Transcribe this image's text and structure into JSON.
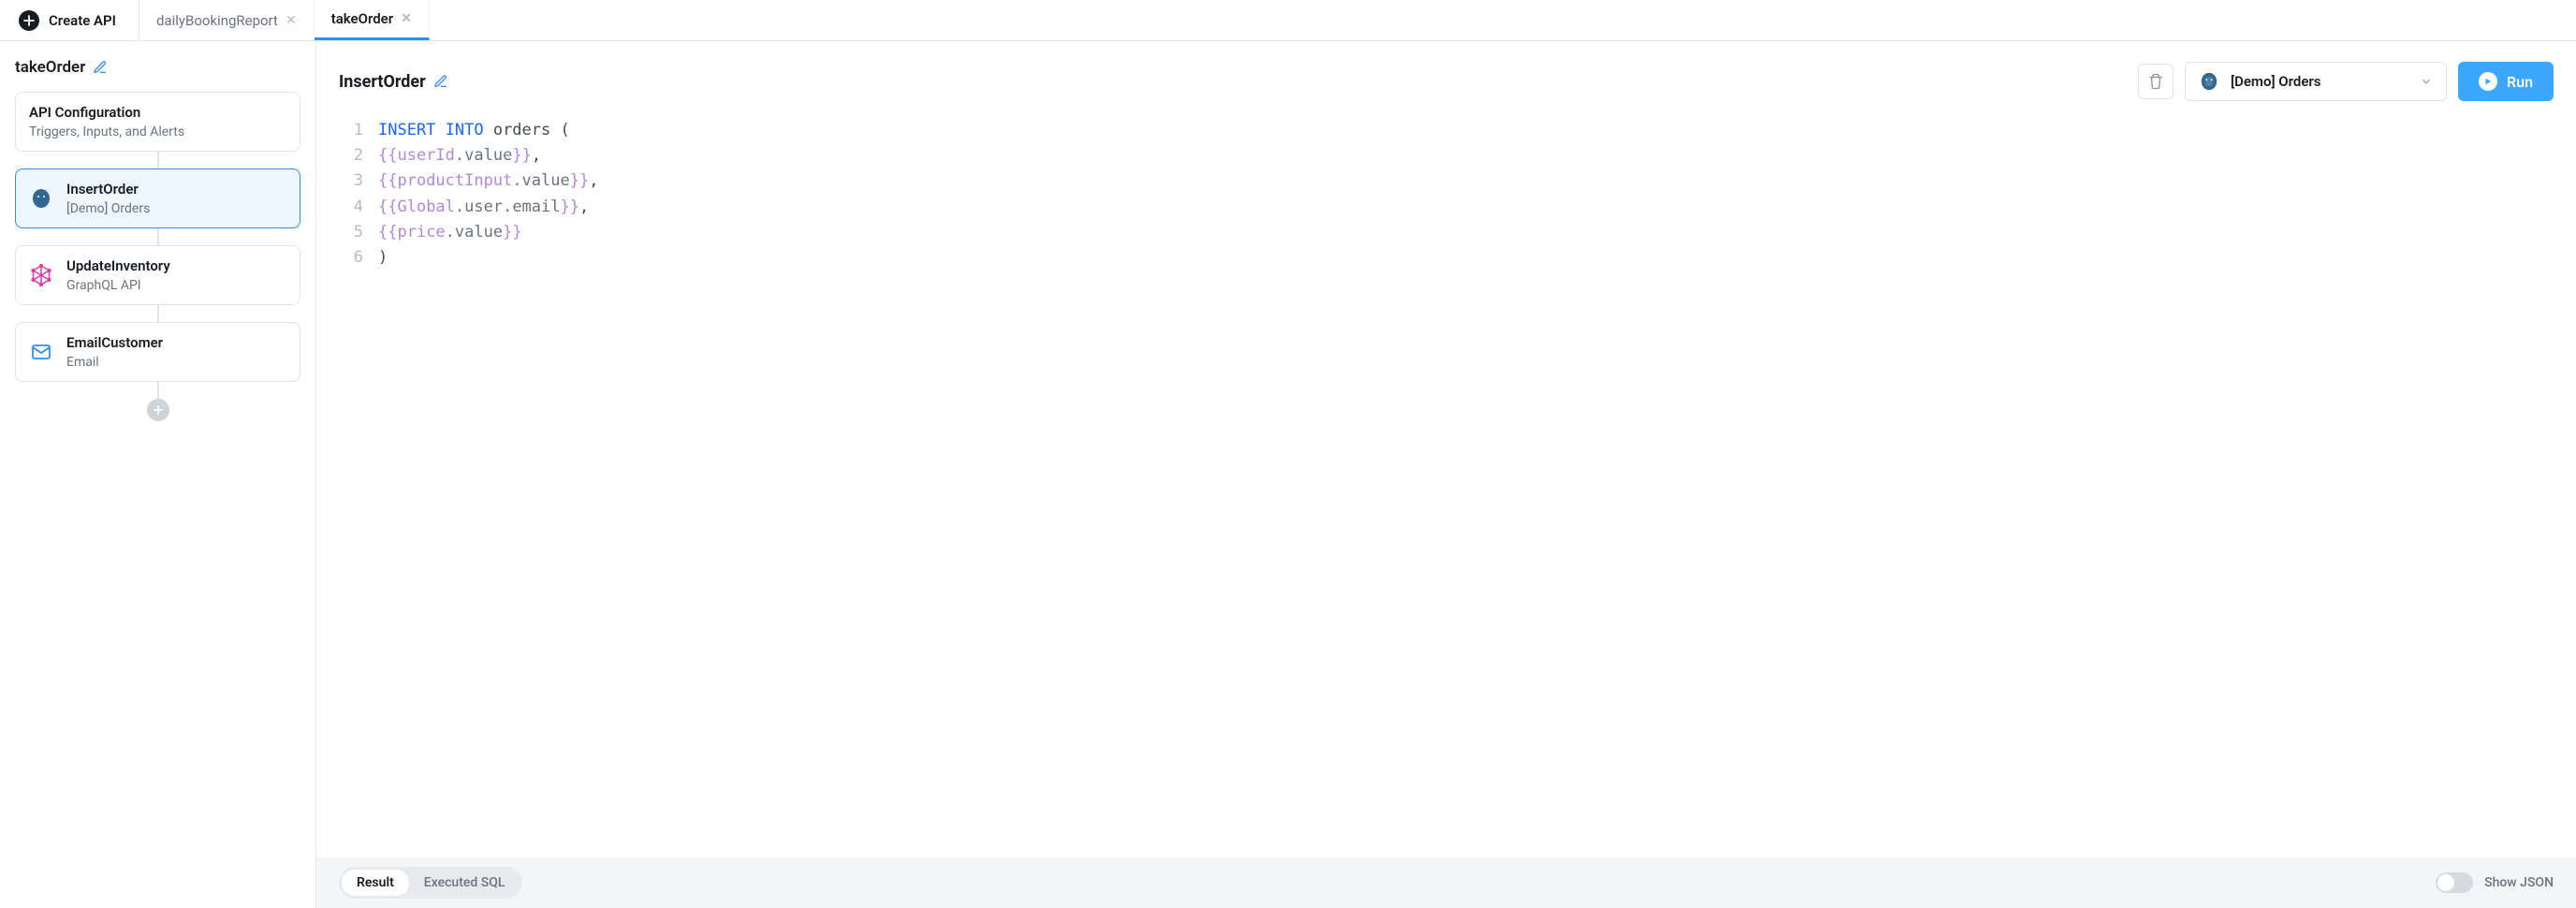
{
  "topbar": {
    "create_label": "Create API",
    "tabs": [
      {
        "label": "dailyBookingReport",
        "active": false
      },
      {
        "label": "takeOrder",
        "active": true
      }
    ]
  },
  "sidebar": {
    "title": "takeOrder",
    "config": {
      "title": "API Configuration",
      "subtitle": "Triggers, Inputs, and Alerts"
    },
    "steps": [
      {
        "name": "InsertOrder",
        "subtitle": "[Demo] Orders",
        "icon": "postgres",
        "selected": true
      },
      {
        "name": "UpdateInventory",
        "subtitle": "GraphQL API",
        "icon": "graphql",
        "selected": false
      },
      {
        "name": "EmailCustomer",
        "subtitle": "Email",
        "icon": "email",
        "selected": false
      }
    ]
  },
  "main": {
    "title": "InsertOrder",
    "datasource": {
      "label": "[Demo] Orders",
      "icon": "postgres"
    },
    "run_label": "Run",
    "code_lines": [
      [
        {
          "cls": "kw",
          "t": "INSERT INTO"
        },
        {
          "cls": "code-default",
          "t": " orders ("
        }
      ],
      [
        {
          "cls": "tmpl",
          "t": "{{"
        },
        {
          "cls": "tmpl",
          "t": "userId"
        },
        {
          "cls": "prop",
          "t": ".value"
        },
        {
          "cls": "tmpl",
          "t": "}}"
        },
        {
          "cls": "code-default",
          "t": ","
        }
      ],
      [
        {
          "cls": "tmpl",
          "t": "{{"
        },
        {
          "cls": "tmpl",
          "t": "productInput"
        },
        {
          "cls": "prop",
          "t": ".value"
        },
        {
          "cls": "tmpl",
          "t": "}}"
        },
        {
          "cls": "code-default",
          "t": ","
        }
      ],
      [
        {
          "cls": "tmpl",
          "t": "{{"
        },
        {
          "cls": "tmpl",
          "t": "Global"
        },
        {
          "cls": "prop",
          "t": ".user.email"
        },
        {
          "cls": "tmpl",
          "t": "}}"
        },
        {
          "cls": "code-default",
          "t": ","
        }
      ],
      [
        {
          "cls": "tmpl",
          "t": "{{"
        },
        {
          "cls": "tmpl",
          "t": "price"
        },
        {
          "cls": "prop",
          "t": ".value"
        },
        {
          "cls": "tmpl",
          "t": "}}"
        }
      ],
      [
        {
          "cls": "code-default",
          "t": ")"
        }
      ]
    ]
  },
  "bottom": {
    "tabs": [
      {
        "label": "Result",
        "active": true
      },
      {
        "label": "Executed SQL",
        "active": false
      }
    ],
    "show_json_label": "Show JSON",
    "show_json_on": false
  },
  "colors": {
    "accent_blue": "#2f8dff",
    "run_blue": "#3ba7ff",
    "graphql_pink": "#e535ab",
    "postgres_blue": "#336791"
  }
}
